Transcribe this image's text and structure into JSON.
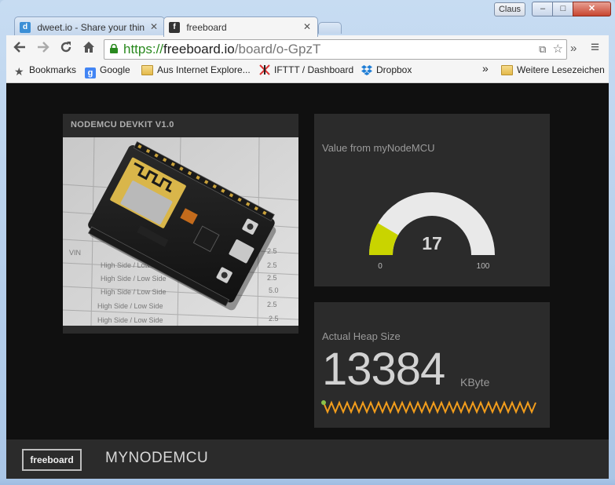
{
  "window": {
    "user_badge": "Claus",
    "minimize_glyph": "–",
    "maximize_glyph": "□",
    "close_glyph": "✕"
  },
  "tabs": [
    {
      "label": "dweet.io - Share your thin",
      "icon_letter": "d",
      "icon_color": "#3b8fd6"
    },
    {
      "label": "freeboard",
      "icon_letter": "f",
      "icon_color": "#333333"
    }
  ],
  "toolbar": {
    "url_scheme": "https://",
    "url_host": "freeboard.io",
    "url_path": "/board/o-GpzT",
    "overflow_glyph": "»",
    "menu_glyph": "≡"
  },
  "bookmarks": {
    "items": [
      {
        "label": "Bookmarks",
        "icon": "star-icon"
      },
      {
        "label": "Google",
        "icon": "google-icon"
      },
      {
        "label": "Aus Internet Explore...",
        "icon": "folder-icon"
      },
      {
        "label": "IFTTT / Dashboard",
        "icon": "ifttt-icon"
      },
      {
        "label": "Dropbox",
        "icon": "dropbox-icon"
      }
    ],
    "overflow_glyph": "»",
    "other_label": "Weitere Lesezeichen"
  },
  "dashboard": {
    "image_pane": {
      "title": "NODEMCU DEVKIT V1.0",
      "sheet_rows": [
        "VIN",
        "High Side / Low Side",
        "High Side / Low Side",
        "High Side / Low Side",
        "High Side / Low Side",
        "High Side / Low Side"
      ],
      "sheet_values": [
        "2.5",
        "2.5",
        "2.5",
        "5.0",
        "2.5",
        "2.5"
      ]
    },
    "gauge": {
      "label": "Value from myNodeMCU",
      "value": 17,
      "min": 0,
      "max": 100,
      "value_text": "17",
      "min_text": "0",
      "max_text": "100",
      "fill_color": "#c9d400",
      "track_color": "#e9e9e9"
    },
    "heap": {
      "label": "Actual Heap Size",
      "value": "13384",
      "unit": "KByte",
      "spark_color": "#f29d1c",
      "spark_start_color": "#8bc34a"
    }
  },
  "footer": {
    "logo_label": "freeboard",
    "board_name": "MYNODEMCU"
  },
  "colors": {
    "background": "#101010",
    "pane": "#2b2b2b",
    "accent": "#c9d400"
  }
}
